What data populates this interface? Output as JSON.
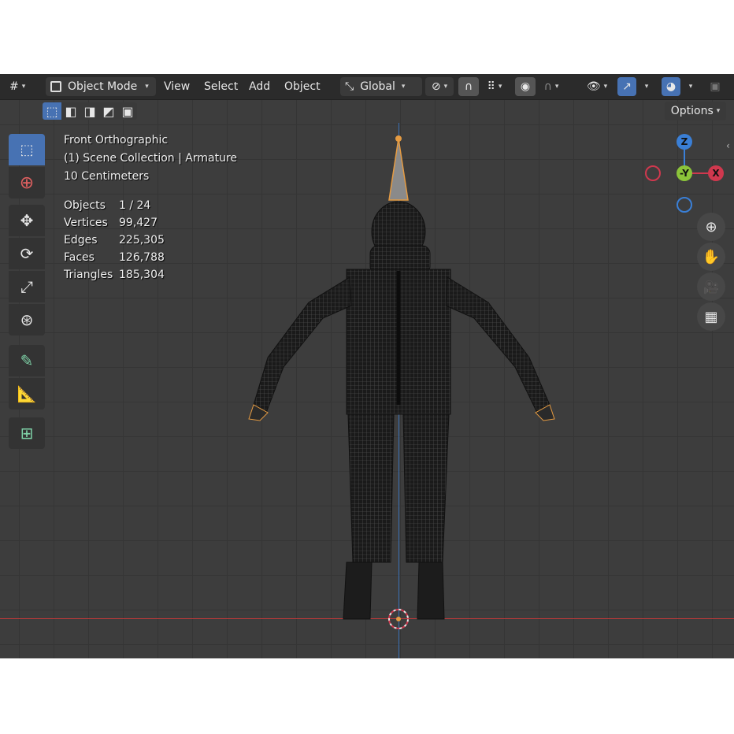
{
  "header": {
    "editor_type_icon": "grid-editor-icon",
    "mode": "Object Mode",
    "menus": [
      "View",
      "Select",
      "Add",
      "Object"
    ],
    "transform_orientation": "Global",
    "options_label": "Options"
  },
  "overlay": {
    "view_name": "Front Orthographic",
    "collection": "(1) Scene Collection | Armature",
    "grid_scale": "10 Centimeters"
  },
  "stats": [
    {
      "label": "Objects",
      "value": "1 / 24"
    },
    {
      "label": "Vertices",
      "value": "99,427"
    },
    {
      "label": "Edges",
      "value": "225,305"
    },
    {
      "label": "Faces",
      "value": "126,788"
    },
    {
      "label": "Triangles",
      "value": "185,304"
    }
  ],
  "gizmo": {
    "z": "Z",
    "y": "-Y",
    "x": "X"
  },
  "colors": {
    "accent": "#4772b3",
    "x_axis": "#d0384e",
    "y_axis": "#8bc43a",
    "z_axis": "#3a7fd6",
    "selection": "#e59b42"
  },
  "tools": [
    "select-box-icon",
    "cursor-icon",
    "move-icon",
    "rotate-icon",
    "scale-icon",
    "transform-icon",
    "annotate-icon",
    "measure-icon",
    "add-cube-icon"
  ],
  "nav_buttons": [
    "zoom-icon",
    "hand-pan-icon",
    "camera-icon",
    "grid-ortho-icon"
  ]
}
